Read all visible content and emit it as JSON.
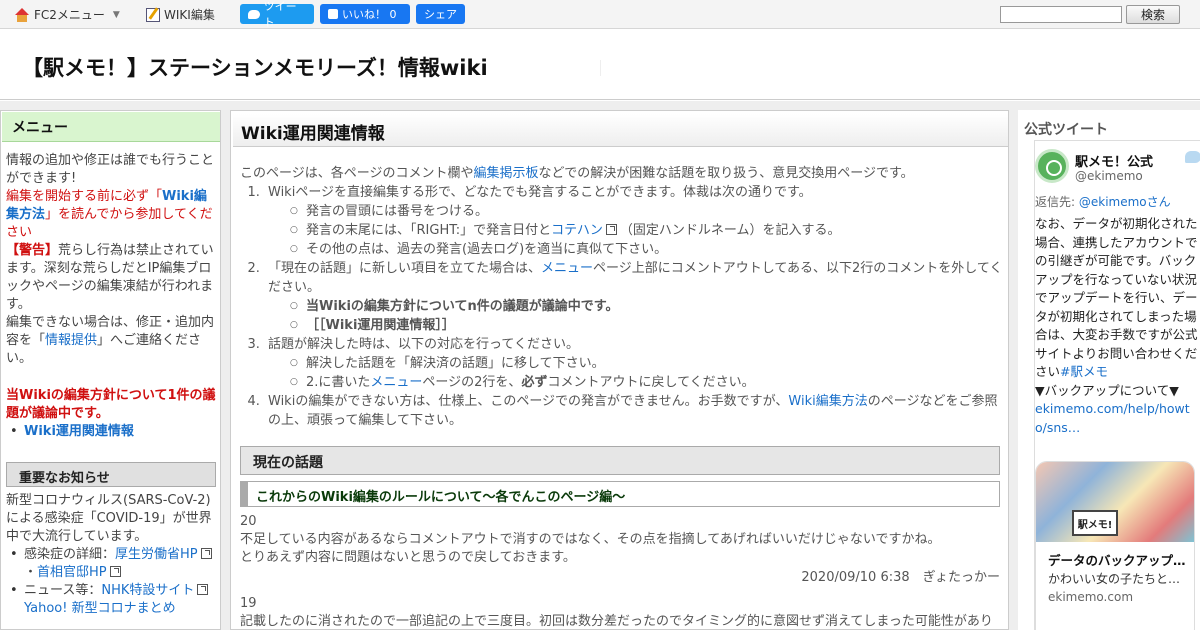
{
  "fc2bar": {
    "menu_label": "FC2メニュー",
    "edit_label": "WIKI編集",
    "tweet_label": "ツイート",
    "like_label": "いいね！ 0",
    "share_label": "シェア",
    "search_button": "検索"
  },
  "header": {
    "title": "【駅メモ！】ステーションメモリーズ！情報wiki"
  },
  "left": {
    "menu_heading": "メニュー",
    "notice1": "情報の追加や修正は誰でも行うことができます!",
    "notice2_pre": "編集を開始する前に必ず「",
    "notice2_link": "Wiki編集方法",
    "notice2_post": "」を読んでから参加してください",
    "warning_tag": "【警告】",
    "warning_text": "荒らし行為は禁止されています。深刻な荒らしだとIP編集ブロックやページの編集凍結が行われます。",
    "contact_pre": "編集できない場合は、修正・追加内容を「",
    "contact_link": "情報提供",
    "contact_post": "」へご連絡ください。",
    "policy_notice": "当Wikiの編集方針について1件の議題が議論中です。",
    "policy_link": "Wiki運用関連情報",
    "news_heading": "重要なお知らせ",
    "news_text": "新型コロナウィルス(SARS-CoV-2)による感染症「COVID-19」が世界中で大流行しています。",
    "news_item1_pre": "感染症の詳細：",
    "news_item1_link1": "厚生労働省HP",
    "news_item1_sep": "・",
    "news_item1_link2": "首相官邸HP",
    "news_item2_pre": "ニュース等：",
    "news_item2_link1": "NHK特設サイト",
    "news_item2_link2": "Yahoo! 新型コロナまとめ"
  },
  "main": {
    "page_title": "Wiki運用関連情報",
    "intro_pre": "このページは、各ページのコメント欄や",
    "intro_link": "編集掲示板",
    "intro_post": "などでの解決が困難な話題を取り扱う、意見交換用ページです。",
    "step1": "Wikiページを直接編集する形で、どなたでも発言することができます。体裁は次の通りです。",
    "step1_a": "発言の冒頭には番号をつける。",
    "step1_b_pre": "発言の末尾には、「RIGHT:」で発言日付と",
    "step1_b_link": "コテハン",
    "step1_b_post": "（固定ハンドルネーム）を記入する。",
    "step1_c": "その他の点は、過去の発言(過去ログ)を適当に真似て下さい。",
    "step2_pre": "「現在の話題」に新しい項目を立てた場合は、",
    "step2_link": "メニュー",
    "step2_post": "ページ上部にコメントアウトしてある、以下2行のコメントを外してください。",
    "step2_a": "当Wikiの編集方針についてn件の議題が議論中です。",
    "step2_b": "［［Wiki運用関連情報］］",
    "step3": "話題が解決した時は、以下の対応を行ってください。",
    "step3_a": "解決した話題を「解決済の話題」に移して下さい。",
    "step3_b_pre": "2.に書いた",
    "step3_b_link": "メニュー",
    "step3_b_mid": "ページの2行を、",
    "step3_b_bold": "必ず",
    "step3_b_post": "コメントアウトに戻してください。",
    "step4_pre": "Wikiの編集ができない方は、仕様上、このページでの発言ができません。お手数ですが、",
    "step4_link": "Wiki編集方法",
    "step4_post": "のページなどをご参照の上、頑張って編集して下さい。",
    "current_topics": "現在の話題",
    "topic_title": "これからのWiki編集のルールについて～各でんこのページ編～",
    "posts": [
      {
        "num": "20",
        "line1": "不足している内容があるならコメントアウトで消すのではなく、その点を指摘してあげればいいだけじゃないですかね。",
        "line2": "とりあえず内容に問題はないと思うので戻しておきます。",
        "meta": "2020/09/10 6:38　ぎょたっかー"
      },
      {
        "num": "19",
        "line1": "記載したのに消されたので一部追記の上で三度目。初回は数分差だったのでタイミング的に意図せず消えてしまった可能性があり"
      }
    ]
  },
  "right": {
    "heading": "公式ツイート",
    "name": "駅メモ！公式",
    "handle": "@ekimemo",
    "reply_pre": "返信先: ",
    "reply_to": "@ekimemoさん",
    "text": "なお、データが初期化された場合、連携したアカウントでの引継ぎが可能です。バックアップを行なっていない状況でアップデートを行い、データが初期化されてしまった場合は、大変お手数ですが公式サイトよりお問い合わせください",
    "hashtag": "#駅メモ",
    "backup_line": "▼バックアップについて▼",
    "url": "ekimemo.com/help/howto/sns…",
    "card_badge": "駅メモ!",
    "card_title": "データのバックアップ…",
    "card_desc": "かわいい女の子たちと…",
    "card_domain": "ekimemo.com"
  }
}
